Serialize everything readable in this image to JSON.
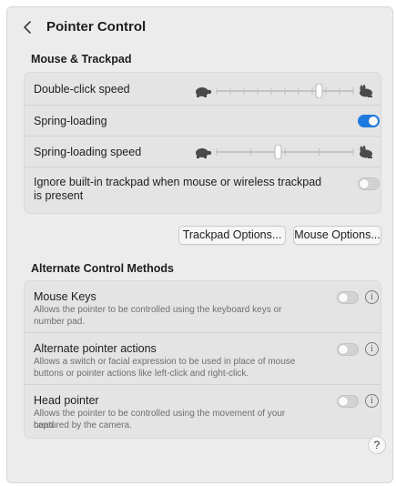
{
  "header": {
    "title": "Pointer Control"
  },
  "mouse_trackpad": {
    "section_title": "Mouse & Trackpad",
    "double_click_speed": {
      "label": "Double-click speed",
      "value_fraction": 0.75,
      "ticks": 11
    },
    "spring_loading": {
      "label": "Spring-loading",
      "enabled": true
    },
    "spring_loading_speed": {
      "label": "Spring-loading speed",
      "value_fraction": 0.45,
      "ticks": 5
    },
    "ignore_trackpad": {
      "label_line1": "Ignore built-in trackpad when mouse or wireless trackpad",
      "label_line2": "is present",
      "enabled": false
    }
  },
  "buttons": {
    "trackpad_options": "Trackpad Options...",
    "mouse_options": "Mouse Options..."
  },
  "alternate": {
    "section_title": "Alternate Control Methods",
    "mouse_keys": {
      "label": "Mouse Keys",
      "desc_line1": "Allows the pointer to be controlled using the keyboard keys or",
      "desc_line2": "number pad.",
      "enabled": false
    },
    "alt_pointer_actions": {
      "label": "Alternate pointer actions",
      "desc_line1": "Allows a switch or facial expression to be used in place of mouse",
      "desc_line2": "buttons or pointer actions like left-click and right-click.",
      "enabled": false
    },
    "head_pointer": {
      "label": "Head pointer",
      "desc_line1": "Allows the pointer to be controlled using the movement of your head",
      "desc_line2": "captured by the camera.",
      "enabled": false
    }
  },
  "info_glyph": "i",
  "help_glyph": "?",
  "colors": {
    "accent": "#1f7ae0",
    "toggle_off": "#d2d2d2",
    "window_bg": "#ececec"
  },
  "icons": {
    "back": "chevron-left-icon",
    "slow": "turtle-icon",
    "fast": "hare-icon",
    "info": "info-icon",
    "help": "help-icon"
  }
}
